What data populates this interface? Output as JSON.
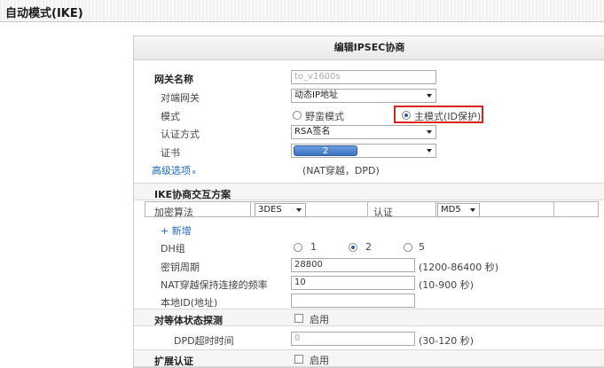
{
  "window": {
    "title": "自动模式(IKE)"
  },
  "panel": {
    "title": "编辑IPSEC协商"
  },
  "gateway": {
    "name_label": "网关名称",
    "name_value": "to_v1600s",
    "peer_label": "对端网关",
    "peer_value": "动态IP地址",
    "mode_label": "模式",
    "mode_aggressive": "野蛮模式",
    "mode_main": "主模式(ID保护)",
    "auth_label": "认证方式",
    "auth_value": "RSA签名",
    "cert_label": "证书",
    "cert_value": "2",
    "advanced_link": "高级选项",
    "advanced_icon": "»",
    "advanced_hint": "(NAT穿越，DPD)"
  },
  "ike": {
    "section_title": "IKE协商交互方案",
    "enc_label": "加密算法",
    "enc_value": "3DES",
    "auth_label": "认证",
    "auth_value": "MD5",
    "add_label": "+ 新增",
    "dh_label": "DH组",
    "dh_options": [
      "1",
      "2",
      "5"
    ],
    "dh_selected": "2",
    "lifetime_label": "密钥周期",
    "lifetime_value": "28800",
    "lifetime_hint": "(1200-86400 秒)",
    "nat_label": "NAT穿越保持连接的频率",
    "nat_value": "10",
    "nat_hint": "(10-900 秒)",
    "localid_label": "本地ID(地址)",
    "localid_value": ""
  },
  "dpd": {
    "section_title": "对等体状态探测",
    "enable_label": "启用",
    "timeout_label": "DPD超时时间",
    "timeout_value": "0",
    "timeout_hint": "(30-120 秒)"
  },
  "ext": {
    "section_title": "扩展认证",
    "enable_label": "启用"
  },
  "colors": {
    "highlight": "#e02020",
    "link": "#1a6ac4"
  }
}
